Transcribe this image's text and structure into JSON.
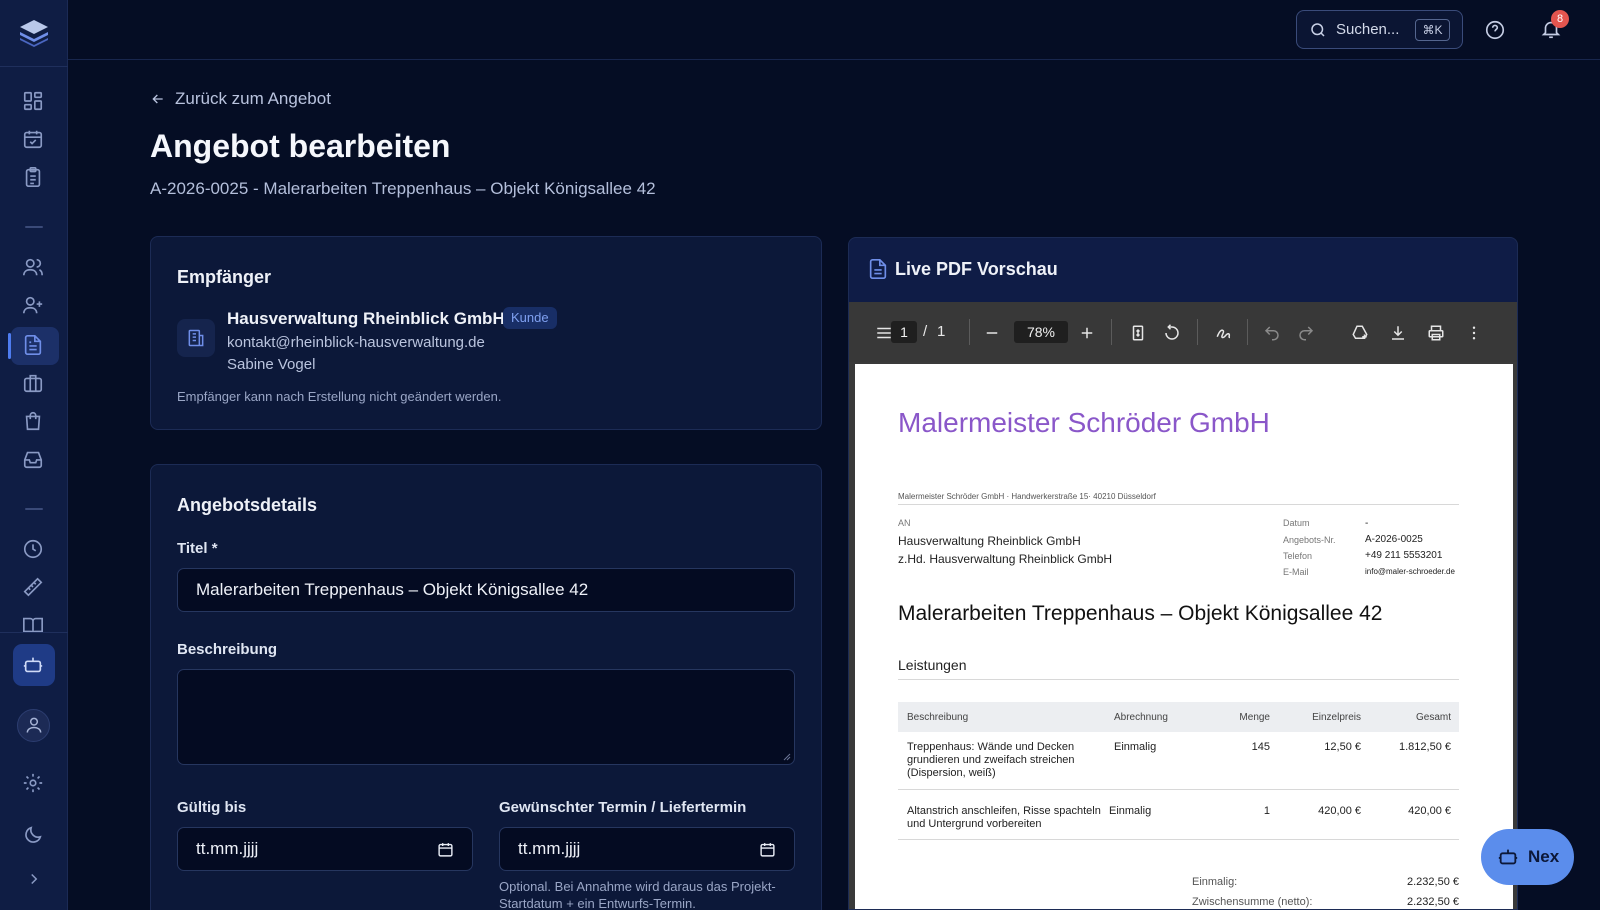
{
  "topbar": {
    "search_label": "Suchen...",
    "search_shortcut": "⌘K",
    "notification_count": "8"
  },
  "header": {
    "back_label": "Zurück zum Angebot",
    "title": "Angebot bearbeiten",
    "subtitle": "A-2026-0025 - Malerarbeiten Treppenhaus – Objekt Königsallee 42"
  },
  "recipient": {
    "heading": "Empfänger",
    "company": "Hausverwaltung Rheinblick GmbH",
    "badge": "Kunde",
    "email": "kontakt@rheinblick-hausverwaltung.de",
    "contact": "Sabine Vogel",
    "note": "Empfänger kann nach Erstellung nicht geändert werden."
  },
  "details": {
    "heading": "Angebotsdetails",
    "title_label": "Titel *",
    "title_value": "Malerarbeiten Treppenhaus – Objekt Königsallee 42",
    "description_label": "Beschreibung",
    "description_value": "",
    "valid_until_label": "Gültig bis",
    "valid_until_placeholder": "tt.mm.jjjj",
    "delivery_label": "Gewünschter Termin / Liefertermin",
    "delivery_placeholder": "tt.mm.jjjj",
    "delivery_hint_1": "Optional. Bei Annahme wird daraus das Projekt-",
    "delivery_hint_2": "Startdatum + ein Entwurfs-Termin."
  },
  "preview": {
    "heading": "Live PDF Vorschau",
    "page_current": "1",
    "page_sep": "/",
    "page_total": "1",
    "zoom": "78%"
  },
  "pdf": {
    "company": "Malermeister Schröder GmbH",
    "sender_line": "Malermeister Schröder GmbH · Handwerkerstraße 15· 40210 Düsseldorf",
    "an_label": "AN",
    "recipient_name": "Hausverwaltung Rheinblick GmbH",
    "recipient_attn": "z.Hd. Hausverwaltung Rheinblick GmbH",
    "meta": [
      {
        "label": "Datum",
        "value": "-"
      },
      {
        "label": "Angebots-Nr.",
        "value": "A-2026-0025"
      },
      {
        "label": "Telefon",
        "value": "+49 211 5553201"
      },
      {
        "label": "E-Mail",
        "value": "info@maler-schroeder.de"
      }
    ],
    "doc_title": "Malerarbeiten Treppenhaus – Objekt Königsallee 42",
    "section": "Leistungen",
    "columns": [
      "Beschreibung",
      "Abrechnung",
      "Menge",
      "Einzelpreis",
      "Gesamt"
    ],
    "rows": [
      {
        "desc_1": "Treppenhaus: Wände und Decken",
        "desc_2": "grundieren und zweifach streichen",
        "desc_3": "(Dispersion, weiß)",
        "billing": "Einmalig",
        "qty": "145",
        "unit": "12,50 €",
        "total": "1.812,50 €"
      },
      {
        "desc_1": "Altanstrich anschleifen, Risse spachteln",
        "desc_2": "und Untergrund vorbereiten",
        "desc_3": "",
        "billing": "Einmalig",
        "qty": "1",
        "unit": "420,00 €",
        "total": "420,00 €"
      }
    ],
    "sum_once_label": "Einmalig:",
    "sum_once_value": "2.232,50 €",
    "subtotal_label": "Zwischensumme (netto):",
    "subtotal_value": "2.232,50 €"
  },
  "assistant": {
    "label": "Nex"
  },
  "colors": {
    "background": "#050d24",
    "sidebar": "#0f1d44",
    "card": "#0c1839",
    "accent": "#4e7cf0",
    "pdf_company": "#8a57c9",
    "badge": "#e3554f"
  }
}
